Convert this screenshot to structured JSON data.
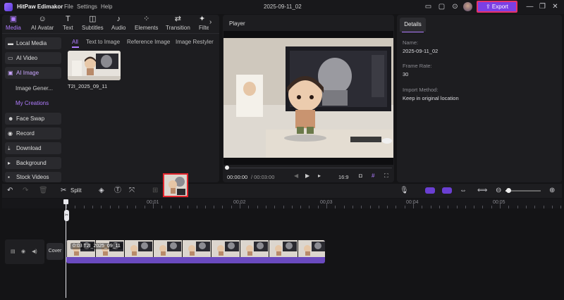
{
  "app": {
    "name": "HitPaw Edimakor",
    "doc_title": "2025-09-11_02"
  },
  "menu": [
    "File",
    "Settings",
    "Help"
  ],
  "export_label": "Export",
  "colors": {
    "accent": "#b07cff",
    "export_bg": "#7b3fe4",
    "highlight": "#e3262e",
    "clip": "#6a4abf"
  },
  "tabs": [
    {
      "label": "Media",
      "icon": "media-icon"
    },
    {
      "label": "AI Avatar",
      "icon": "ai-avatar-icon"
    },
    {
      "label": "Text",
      "icon": "text-icon"
    },
    {
      "label": "Subtitles",
      "icon": "subtitles-icon"
    },
    {
      "label": "Audio",
      "icon": "audio-icon"
    },
    {
      "label": "Elements",
      "icon": "elements-icon"
    },
    {
      "label": "Transition",
      "icon": "transition-icon"
    },
    {
      "label": "Filter",
      "icon": "filter-icon"
    }
  ],
  "sidebar": {
    "items": [
      "Local Media",
      "AI Video",
      "AI Image"
    ],
    "sub": [
      "Image Gener...",
      "My Creations"
    ],
    "more": [
      "Face Swap",
      "Record",
      "Download",
      "Background",
      "Stock Videos"
    ]
  },
  "subtabs": [
    "All",
    "Text to Image",
    "Reference Image",
    "Image Restyler"
  ],
  "media_item": {
    "label": "T2I_2025_09_11"
  },
  "player": {
    "title": "Player",
    "time_current": "00:00:00",
    "time_total": "/ 00:03:00",
    "ratio": "16:9"
  },
  "details": {
    "tab": "Details",
    "name_label": "Name:",
    "name_value": "2025-09-11_02",
    "frame_rate_label": "Frame Rate:",
    "frame_rate_value": "30",
    "import_label": "Import Method:",
    "import_value": "Keep in original location"
  },
  "toolbar": {
    "split_label": "Split"
  },
  "timeline": {
    "ticks": [
      "00:01",
      "00:02",
      "00:03",
      "00:04",
      "00:05"
    ],
    "cover_label": "Cover",
    "clip_label": "0:03 T2I_2025_09_11",
    "zoom_level": 0.1
  }
}
